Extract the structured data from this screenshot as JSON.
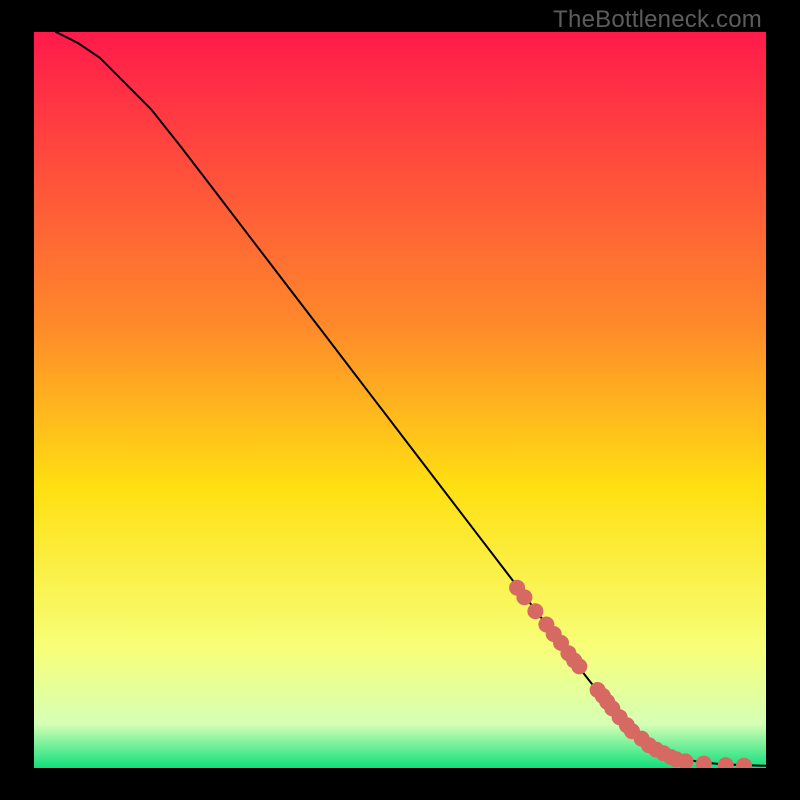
{
  "watermark": "TheBottleneck.com",
  "colors": {
    "gradient_top": "#ff1a4b",
    "gradient_mid1": "#ff8a2a",
    "gradient_mid2": "#ffe012",
    "gradient_mid3": "#f7ff7a",
    "gradient_mid4": "#d6ffb5",
    "gradient_bottom": "#10e07c",
    "curve": "#000000",
    "marker": "#d66a62"
  },
  "chart_data": {
    "type": "line",
    "title": "",
    "xlabel": "",
    "ylabel": "",
    "xlim": [
      0,
      100
    ],
    "ylim": [
      0,
      100
    ],
    "curve": {
      "x": [
        3,
        6,
        9,
        12,
        16,
        20,
        25,
        30,
        35,
        40,
        45,
        50,
        55,
        60,
        65,
        70,
        73,
        76,
        79,
        81,
        83,
        85,
        88,
        91,
        94,
        97,
        100
      ],
      "y": [
        100,
        98.5,
        96.5,
        93.5,
        89.5,
        84.5,
        78,
        71.5,
        65,
        58.5,
        52,
        45.5,
        39,
        32.5,
        26,
        19.5,
        15.5,
        11.7,
        8.0,
        5.7,
        3.9,
        2.5,
        1.4,
        0.8,
        0.5,
        0.4,
        0.3
      ]
    },
    "markers": {
      "x": [
        66,
        67,
        68.5,
        70,
        71,
        72,
        73,
        73.8,
        74.5,
        77,
        77.7,
        78.3,
        79,
        80,
        81,
        81.7,
        83,
        84,
        85,
        86,
        87,
        87.7,
        89,
        91.5,
        94.5,
        97
      ],
      "y": [
        24.5,
        23.2,
        21.3,
        19.5,
        18.2,
        17.0,
        15.6,
        14.6,
        13.8,
        10.6,
        9.8,
        9.0,
        8.1,
        6.9,
        5.8,
        5.0,
        4.0,
        3.1,
        2.5,
        2.0,
        1.5,
        1.2,
        0.9,
        0.6,
        0.4,
        0.3
      ]
    }
  }
}
